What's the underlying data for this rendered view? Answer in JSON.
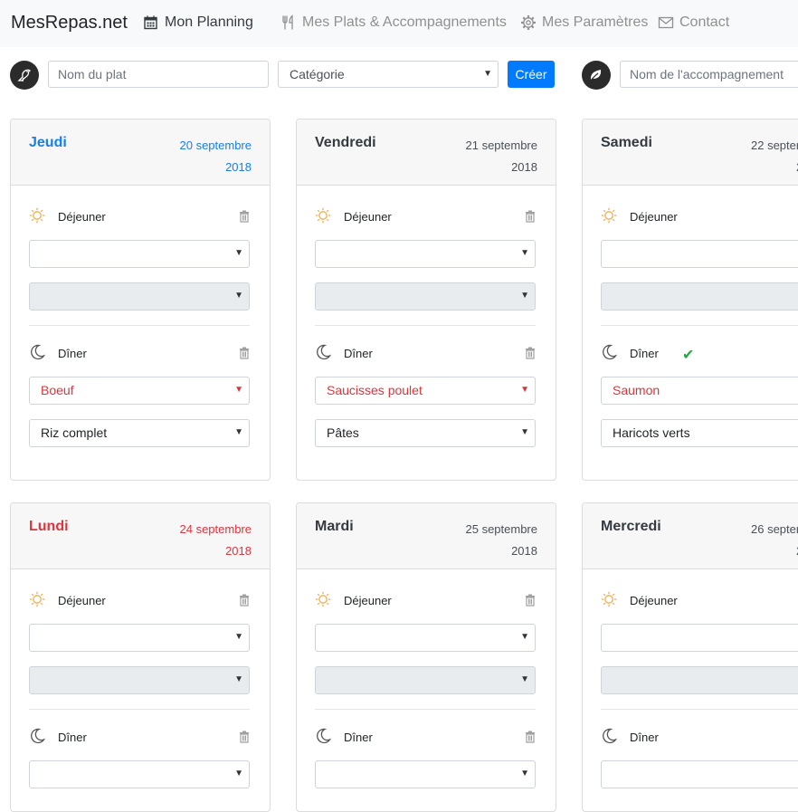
{
  "navbar": {
    "brand": "MesRepas.net",
    "items": [
      {
        "label": "Mon Planning",
        "icon": "calendar-icon"
      },
      {
        "label": "Mes Plats & Accompagnements",
        "icon": "utensils-icon"
      },
      {
        "label": "Mes Paramètres",
        "icon": "gear-icon"
      },
      {
        "label": "Contact",
        "icon": "envelope-icon"
      }
    ]
  },
  "toolbar": {
    "dish_placeholder": "Nom du plat",
    "category_label": "Catégorie",
    "create_label": "Créer",
    "side_placeholder": "Nom de l'accompagnement"
  },
  "meal_labels": {
    "lunch": "Déjeuner",
    "dinner": "Dîner"
  },
  "days": [
    {
      "name": "Jeudi",
      "date_line1": "20 septembre",
      "date_line2": "2018",
      "state": "today",
      "lunch": {
        "dish": "",
        "side": ""
      },
      "dinner": {
        "dish": "Boeuf",
        "side": "Riz complet"
      }
    },
    {
      "name": "Vendredi",
      "date_line1": "21 septembre",
      "date_line2": "2018",
      "state": "normal",
      "lunch": {
        "dish": "",
        "side": ""
      },
      "dinner": {
        "dish": "Saucisses poulet",
        "side": "Pâtes"
      }
    },
    {
      "name": "Samedi",
      "date_line1": "22 septer",
      "date_line2": "2",
      "state": "normal",
      "lunch": {
        "dish": "",
        "side": ""
      },
      "dinner": {
        "dish": "Saumon",
        "side": "Haricots verts"
      }
    },
    {
      "name": "Lundi",
      "date_line1": "24 septembre",
      "date_line2": "2018",
      "state": "weekend",
      "lunch": {
        "dish": "",
        "side": ""
      },
      "dinner": {
        "dish": ""
      }
    },
    {
      "name": "Mardi",
      "date_line1": "25 septembre",
      "date_line2": "2018",
      "state": "normal",
      "lunch": {
        "dish": "",
        "side": ""
      },
      "dinner": {
        "dish": ""
      }
    },
    {
      "name": "Mercredi",
      "date_line1": "26 septer",
      "date_line2": "2",
      "state": "normal",
      "lunch": {
        "dish": "",
        "side": ""
      },
      "dinner": {
        "dish": ""
      }
    }
  ],
  "colors": {
    "primary": "#007bff",
    "today": "#1a7ee6",
    "danger": "#d9363e",
    "success": "#28a745",
    "sun": "#f0ad4e"
  }
}
